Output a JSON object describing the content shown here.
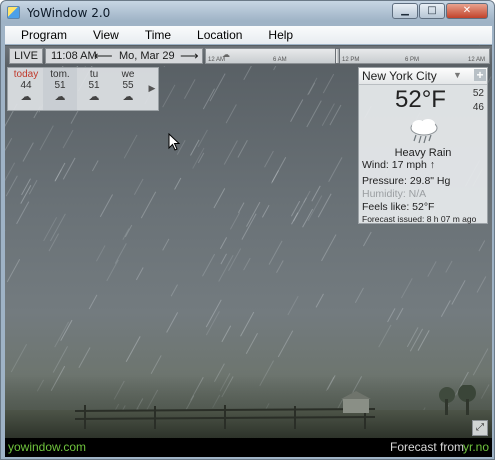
{
  "window": {
    "title": "YoWindow 2.0",
    "minimize_glyph": "▁",
    "maximize_glyph": "□",
    "close_glyph": "✕"
  },
  "menu": [
    "Program",
    "View",
    "Time",
    "Location",
    "Help"
  ],
  "timeline": {
    "live_label": "LIVE",
    "time": "11:08 AM",
    "date": "Mo, Mar 29",
    "prev_arrow": "⟵",
    "next_arrow": "⟶",
    "ticks": [
      "12 AM",
      "6 AM",
      "12 PM",
      "6 PM",
      "12 AM"
    ]
  },
  "forecast": {
    "days": [
      {
        "name": "today",
        "temp": "44",
        "icon": "rain-cloud-icon"
      },
      {
        "name": "tom.",
        "temp": "51",
        "icon": "rain-cloud-icon"
      },
      {
        "name": "tu",
        "temp": "51",
        "icon": "rain-cloud-icon"
      },
      {
        "name": "we",
        "temp": "55",
        "icon": "rain-cloud-icon"
      }
    ],
    "more_arrow": "▶"
  },
  "city": {
    "name": "New York City",
    "dropdown_glyph": "▼",
    "add_glyph": "+",
    "temperature": "52°F",
    "high": "52",
    "low": "46",
    "condition": "Heavy Rain",
    "wind": "Wind:  17 mph ↑",
    "pressure": "Pressure:  29.8\" Hg",
    "humidity": "Humidity:  N/A",
    "feels_like": "Feels like:   52°F",
    "forecast_issued": "Forecast issued:  8 h 07 m ago"
  },
  "footer": {
    "site": "yowindow.com",
    "forecast_label": "Forecast from",
    "forecast_source": "yr.no"
  },
  "colors": {
    "today_label": "#c0392b",
    "footer_link": "#6fc33d",
    "sky_top": "#575e63",
    "sky_bottom": "#737b7f"
  }
}
